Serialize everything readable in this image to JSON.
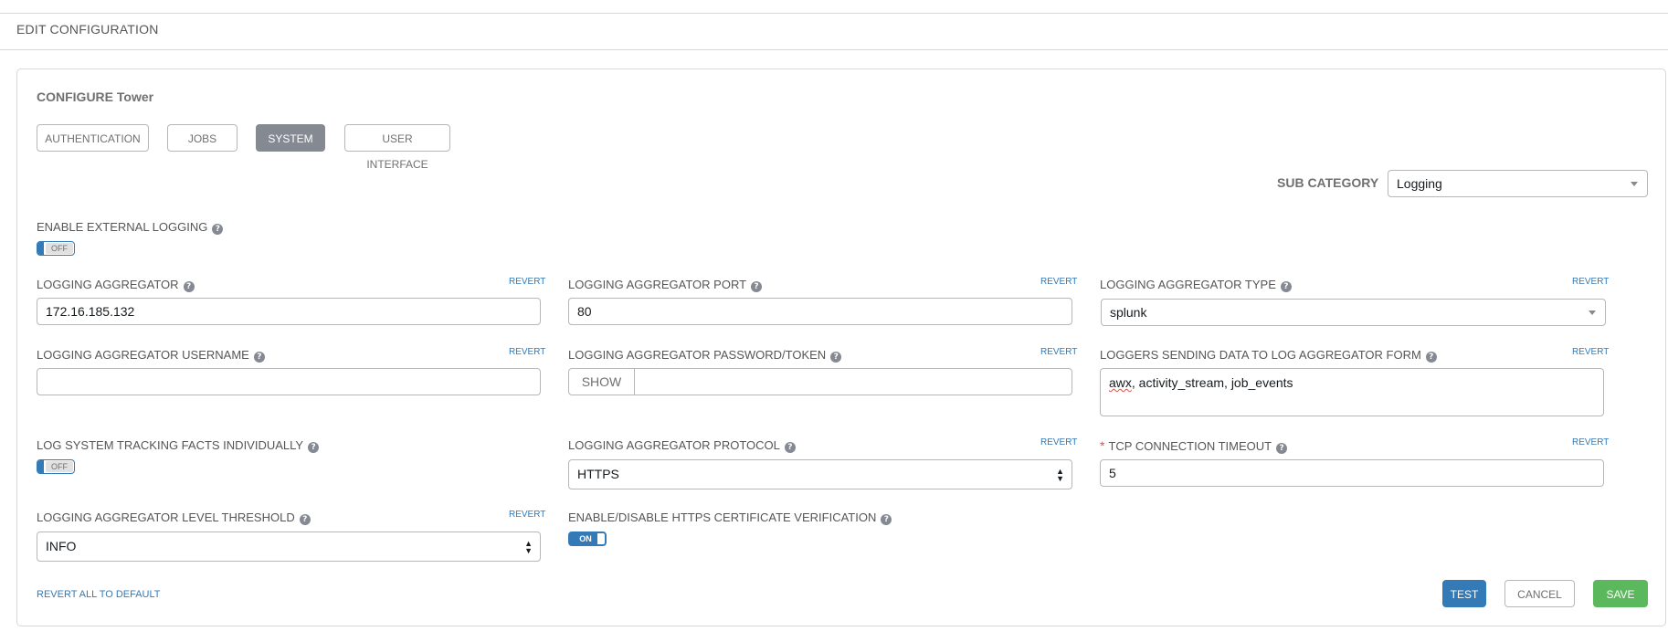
{
  "header": {
    "title": "EDIT CONFIGURATION"
  },
  "panel": {
    "title": "CONFIGURE Tower",
    "tabs": [
      {
        "label": "AUTHENTICATION",
        "active": false
      },
      {
        "label": "JOBS",
        "active": false
      },
      {
        "label": "SYSTEM",
        "active": true
      },
      {
        "label": "USER INTERFACE",
        "active": false
      }
    ]
  },
  "sub_category": {
    "label": "SUB CATEGORY",
    "value": "Logging"
  },
  "help_glyph": "?",
  "revert_label": "REVERT",
  "fields": {
    "enable_external_logging": {
      "label": "ENABLE EXTERNAL LOGGING",
      "state": "OFF"
    },
    "logging_aggregator": {
      "label": "LOGGING AGGREGATOR",
      "value": "172.16.185.132"
    },
    "logging_aggregator_port": {
      "label": "LOGGING AGGREGATOR PORT",
      "value": "80"
    },
    "logging_aggregator_type": {
      "label": "LOGGING AGGREGATOR TYPE",
      "value": "splunk"
    },
    "logging_aggregator_username": {
      "label": "LOGGING AGGREGATOR USERNAME",
      "value": ""
    },
    "logging_aggregator_password": {
      "label": "LOGGING AGGREGATOR PASSWORD/TOKEN",
      "show_label": "SHOW",
      "value": ""
    },
    "loggers_sending_data": {
      "label": "LOGGERS SENDING DATA TO LOG AGGREGATOR FORM",
      "value_first": "awx",
      "value_rest": ", activity_stream, job_events"
    },
    "log_system_tracking_facts": {
      "label": "LOG SYSTEM TRACKING FACTS INDIVIDUALLY",
      "state": "OFF"
    },
    "logging_aggregator_protocol": {
      "label": "LOGGING AGGREGATOR PROTOCOL",
      "value": "HTTPS"
    },
    "tcp_connection_timeout": {
      "label": "TCP CONNECTION TIMEOUT",
      "required_mark": "*",
      "value": "5"
    },
    "logging_aggregator_level_threshold": {
      "label": "LOGGING AGGREGATOR LEVEL THRESHOLD",
      "value": "INFO"
    },
    "https_cert_verification": {
      "label": "ENABLE/DISABLE HTTPS CERTIFICATE VERIFICATION",
      "state": "ON"
    }
  },
  "footer": {
    "revert_all": "REVERT ALL TO DEFAULT",
    "test": "TEST",
    "cancel": "CANCEL",
    "save": "SAVE"
  },
  "colors": {
    "primary": "#337ab7",
    "success": "#5cb85c",
    "active_tab": "#848992",
    "required": "#d9534f"
  }
}
